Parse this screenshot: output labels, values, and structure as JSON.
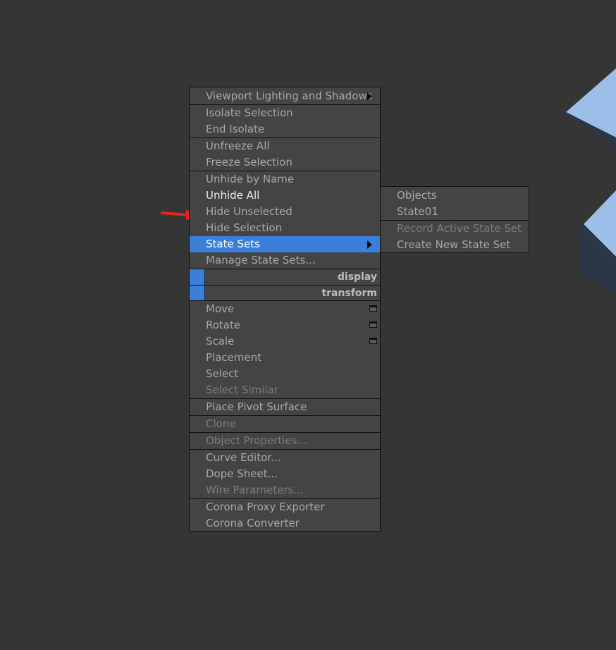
{
  "main_menu": {
    "items": [
      {
        "label": "Viewport Lighting and Shadows",
        "state": "normal",
        "submenu": true
      },
      {
        "label": "Isolate Selection",
        "state": "normal"
      },
      {
        "label": "End Isolate",
        "state": "normal"
      },
      {
        "label": "Unfreeze All",
        "state": "normal"
      },
      {
        "label": "Freeze Selection",
        "state": "normal"
      },
      {
        "label": "Unhide by Name",
        "state": "normal"
      },
      {
        "label": "Unhide All",
        "state": "bright"
      },
      {
        "label": "Hide Unselected",
        "state": "normal"
      },
      {
        "label": "Hide Selection",
        "state": "normal"
      },
      {
        "label": "State Sets",
        "state": "highlighted",
        "submenu": true
      },
      {
        "label": "Manage State Sets...",
        "state": "normal"
      },
      {
        "label": "Move",
        "state": "normal",
        "options": true
      },
      {
        "label": "Rotate",
        "state": "normal",
        "options": true
      },
      {
        "label": "Scale",
        "state": "normal",
        "options": true
      },
      {
        "label": "Placement",
        "state": "normal"
      },
      {
        "label": "Select",
        "state": "normal"
      },
      {
        "label": "Select Similar",
        "state": "disabled"
      },
      {
        "label": "Place Pivot Surface",
        "state": "normal"
      },
      {
        "label": "Clone",
        "state": "disabled"
      },
      {
        "label": "Object Properties...",
        "state": "disabled"
      },
      {
        "label": "Curve Editor...",
        "state": "normal"
      },
      {
        "label": "Dope Sheet...",
        "state": "normal"
      },
      {
        "label": "Wire Parameters...",
        "state": "disabled"
      },
      {
        "label": "Corona Proxy Exporter",
        "state": "normal"
      },
      {
        "label": "Corona Converter",
        "state": "normal"
      }
    ],
    "headers": {
      "display": "display",
      "transform": "transform"
    }
  },
  "submenu": {
    "items": [
      {
        "label": "Objects",
        "state": "normal"
      },
      {
        "label": "State01",
        "state": "normal"
      },
      {
        "label": "Record Active State Set",
        "state": "disabled"
      },
      {
        "label": "Create New State Set",
        "state": "normal"
      }
    ]
  },
  "colors": {
    "background": "#353535",
    "menu": "#444444",
    "highlight": "#3b80d8",
    "annotation_arrow": "#e8231e",
    "viewport_object": "#9bbfe8"
  }
}
